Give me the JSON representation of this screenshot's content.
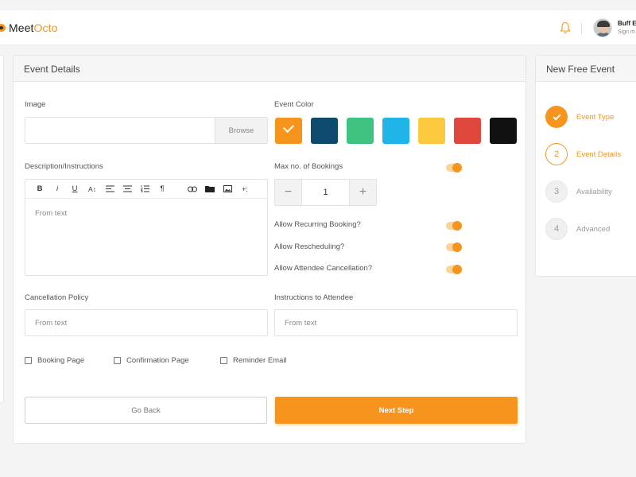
{
  "app": {
    "brand_prefix": "Meet",
    "brand_suffix": "Octo"
  },
  "user": {
    "name": "Buff E",
    "subtitle": "Sign m"
  },
  "main": {
    "title": "Event Details",
    "image_label": "Image",
    "browse_label": "Browse",
    "event_color_label": "Event Color",
    "colors": [
      "#f7941d",
      "#0e4a6e",
      "#3fc380",
      "#1fb5e8",
      "#fcc83d",
      "#e0483e",
      "#111111"
    ],
    "selected_color_index": 0,
    "description_label": "Description/Instructions",
    "editor_placeholder": "From text",
    "toolbar": {
      "bold": "B",
      "italic": "i",
      "underline": "U",
      "font_size": "A↕",
      "paragraph": "¶",
      "more": "+:"
    },
    "max_bookings_label": "Max no. of Bookings",
    "max_bookings_value": "1",
    "stepper_minus": "−",
    "stepper_plus": "+",
    "allow_recurring_label": "Allow Recurring Booking?",
    "allow_rescheduling_label": "Allow Rescheduling?",
    "allow_cancellation_label": "Allow Attendee Cancellation?",
    "toggles": {
      "max_bookings": true,
      "recurring": true,
      "rescheduling": true,
      "cancellation": true
    },
    "cancellation_policy_label": "Cancellation Policy",
    "cancellation_policy_placeholder": "From text",
    "instructions_label": "Instructions to Attendee",
    "instructions_placeholder": "From text",
    "checkboxes": [
      {
        "label": "Booking Page",
        "checked": false
      },
      {
        "label": "Confirmation Page",
        "checked": false
      },
      {
        "label": "Reminder Email",
        "checked": false
      }
    ],
    "back_label": "Go Back",
    "next_label": "Next Step"
  },
  "side": {
    "title": "New Free Event",
    "steps": [
      {
        "number": "",
        "label": "Event Type",
        "state": "done"
      },
      {
        "number": "2",
        "label": "Event Details",
        "state": "active"
      },
      {
        "number": "3",
        "label": "Availability",
        "state": "pending"
      },
      {
        "number": "4",
        "label": "Advanced",
        "state": "pending"
      }
    ]
  },
  "colors": {
    "accent": "#f7941d",
    "accent_light": "#fbd29b",
    "active_text": "#f7941d",
    "pending_text": "#999999"
  }
}
